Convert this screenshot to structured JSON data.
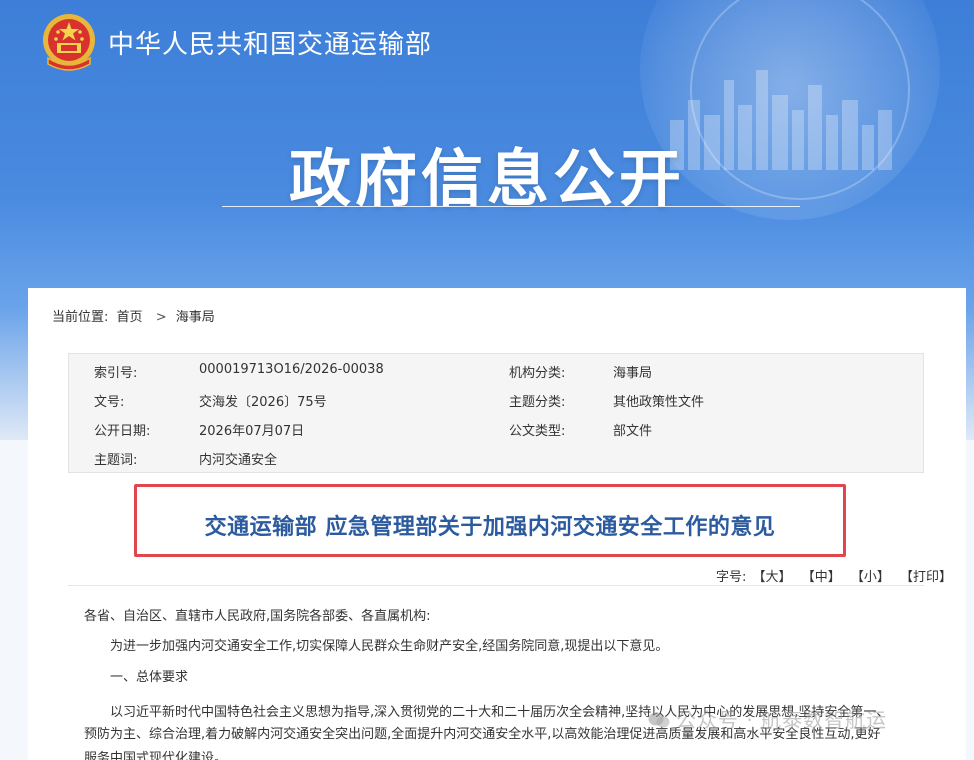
{
  "header": {
    "ministry_name": "中华人民共和国交通运输部",
    "banner_title": "政府信息公开"
  },
  "breadcrumb": {
    "label": "当前位置:",
    "items": [
      "首页",
      "海事局"
    ],
    "separator": ">"
  },
  "meta": {
    "rows": [
      {
        "k1": "索引号:",
        "v1": "000019713O16/2026-00038",
        "k2": "机构分类:",
        "v2": "海事局"
      },
      {
        "k1": "文号:",
        "v1": "交海发〔2026〕75号",
        "k2": "主题分类:",
        "v2": "其他政策性文件"
      },
      {
        "k1": "公开日期:",
        "v1": "2026年07月07日",
        "k2": "公文类型:",
        "v2": "部文件"
      },
      {
        "k1": "主题词:",
        "v1": "内河交通安全",
        "k2": "",
        "v2": ""
      }
    ]
  },
  "document": {
    "title": "交通运输部 应急管理部关于加强内河交通安全工作的意见"
  },
  "font_size_bar": {
    "label": "字号:",
    "large": "【大】",
    "medium": "【中】",
    "small": "【小】",
    "print": "【打印】"
  },
  "body": {
    "salutation": "各省、自治区、直辖市人民政府,国务院各部委、各直属机构:",
    "intro": "为进一步加强内河交通安全工作,切实保障人民群众生命财产安全,经国务院同意,现提出以下意见。",
    "section_1": "一、总体要求",
    "para_1_line_1": "以习近平新时代中国特色社会主义思想为指导,深入贯彻党的二十大和二十届历次全会精神,坚持以人民为中心的发展思想,坚持安全第一、",
    "para_1_line_2": "预防为主、综合治理,着力破解内河交通安全突出问题,全面提升内河交通安全水平,以高效能治理促进高质量发展和高水平安全良性互动,更好",
    "para_1_line_3": "服务中国式现代化建设。"
  },
  "watermark": {
    "text": "公众号 · 航泰数智航运"
  },
  "colors": {
    "hero_blue": "#3d7ed8",
    "title_blue": "#2b5b9e",
    "highlight_red": "#e0464b"
  }
}
